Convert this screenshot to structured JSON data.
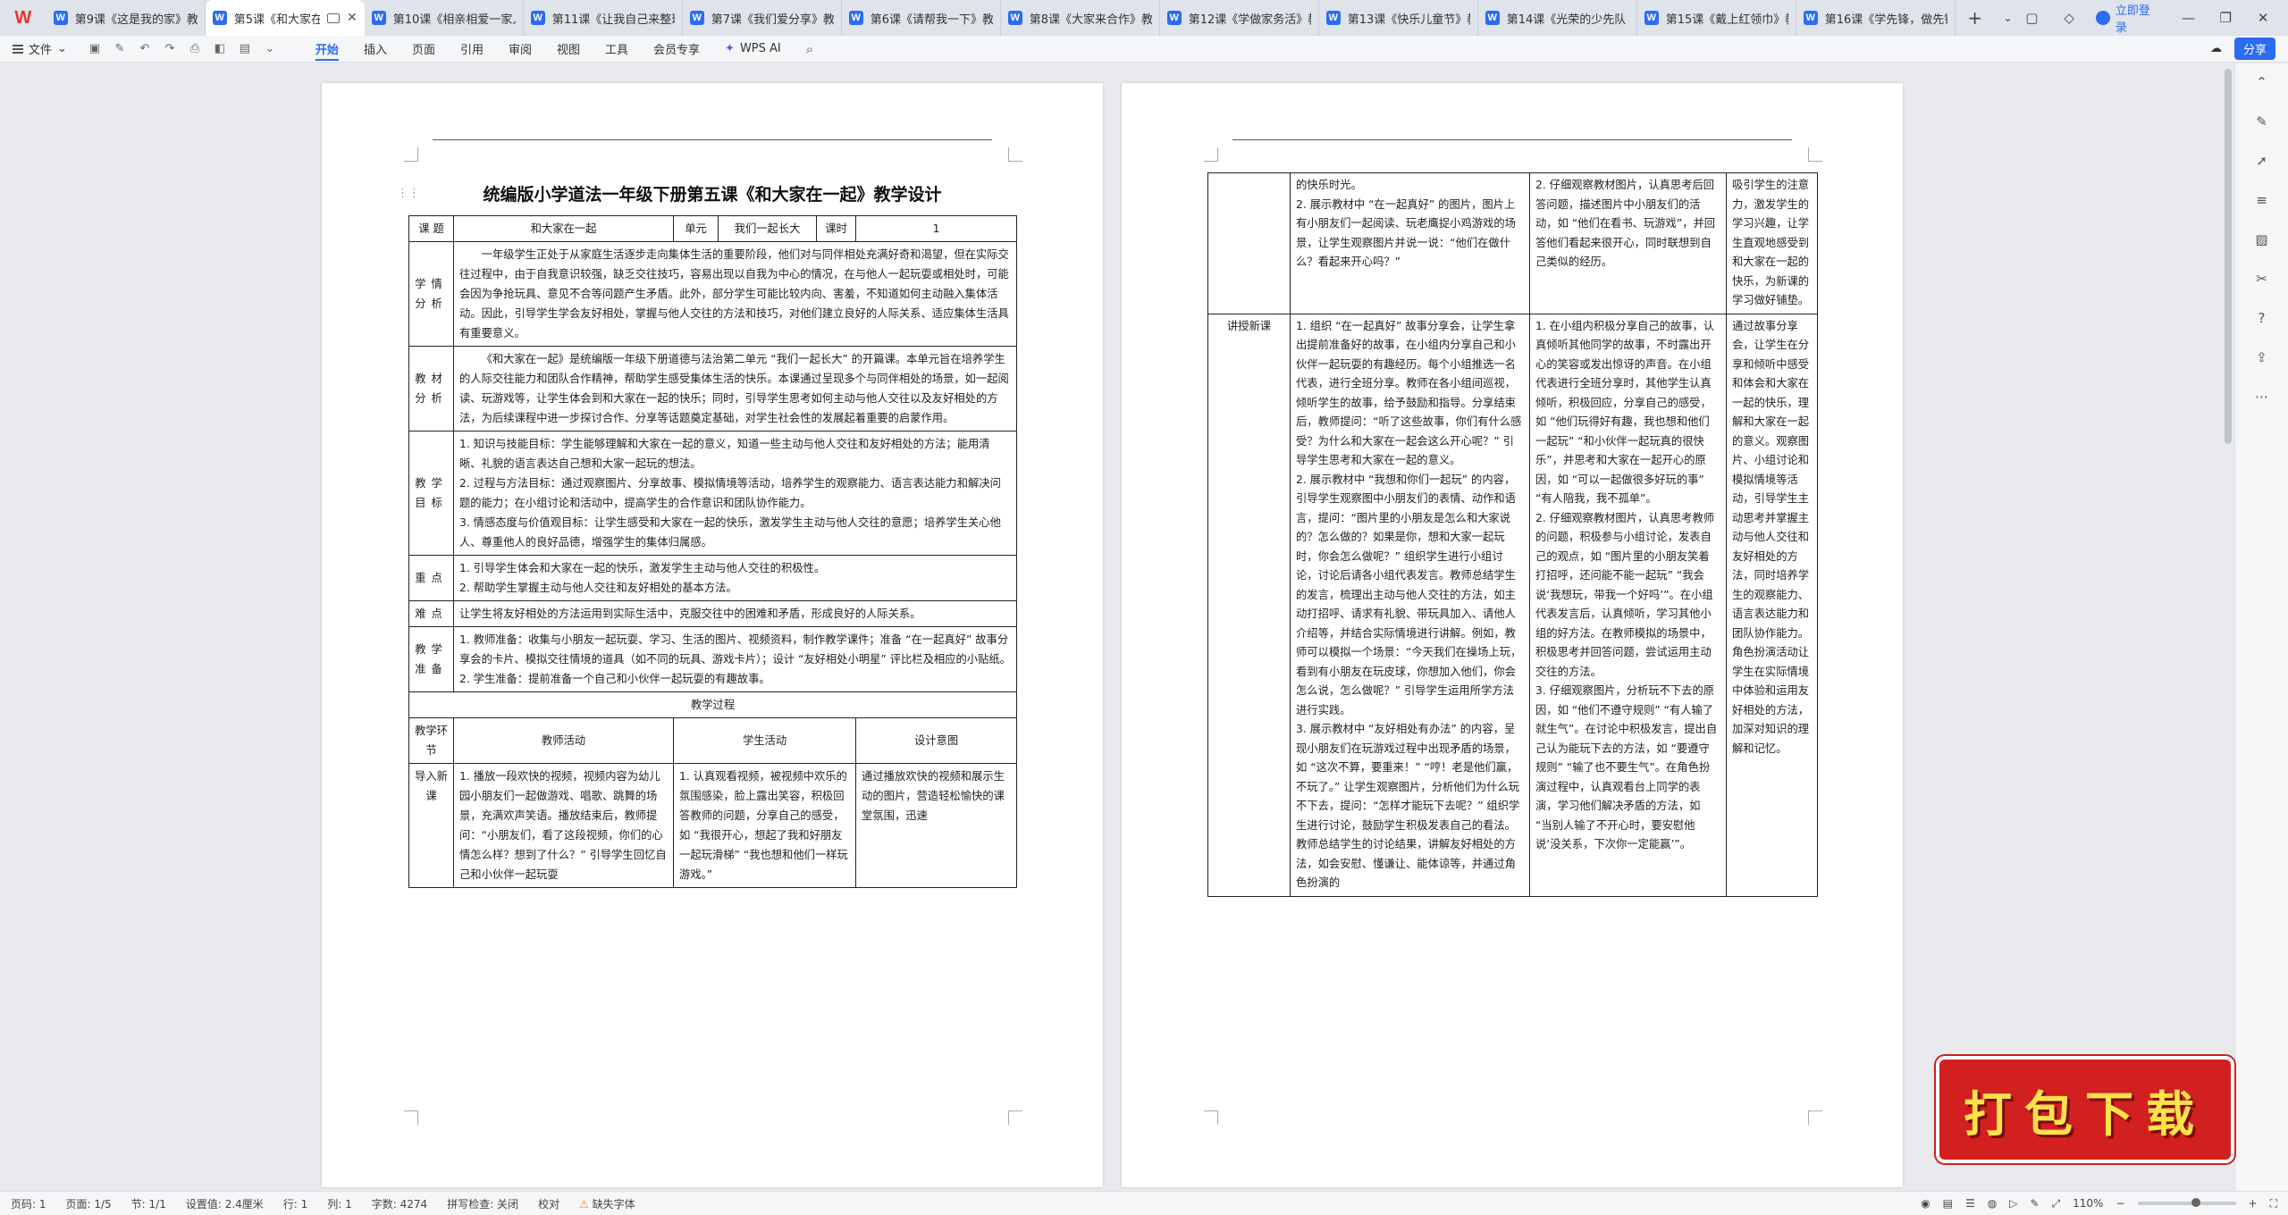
{
  "tabs": [
    {
      "label": "第9课《这是我的家》教",
      "active": false
    },
    {
      "label": "第5课《和大家在",
      "active": true
    },
    {
      "label": "第10课《相亲相爱一家人",
      "active": false
    },
    {
      "label": "第11课《让我自己来整理",
      "active": false
    },
    {
      "label": "第7课《我们爱分享》教",
      "active": false
    },
    {
      "label": "第6课《请帮我一下》教",
      "active": false
    },
    {
      "label": "第8课《大家来合作》教",
      "active": false
    },
    {
      "label": "第12课《学做家务活》教",
      "active": false
    },
    {
      "label": "第13课《快乐儿童节》教",
      "active": false
    },
    {
      "label": "第14课《光荣的少先队",
      "active": false
    },
    {
      "label": "第15课《戴上红领巾》教",
      "active": false
    },
    {
      "label": "第16课《学先锋，做先锋",
      "active": false
    }
  ],
  "login_label": "立即登录",
  "ribbon": {
    "file": "文件",
    "menus": [
      "开始",
      "插入",
      "页面",
      "引用",
      "审阅",
      "视图",
      "工具",
      "会员专享"
    ],
    "active_menu": "开始",
    "wps_ai": "WPS AI",
    "share": "分享"
  },
  "doc": {
    "title": "统编版小学道法一年级下册第五课《和大家在一起》教学设计",
    "header_row": {
      "k_topic": "课  题",
      "v_topic": "和大家在一起",
      "k_unit": "单元",
      "v_unit": "我们一起长大",
      "k_period": "课时",
      "v_period": "1"
    },
    "sections": {
      "xueqing": {
        "label": "学情分析",
        "text": "一年级学生正处于从家庭生活逐步走向集体生活的重要阶段，他们对与同伴相处充满好奇和渴望，但在实际交往过程中，由于自我意识较强，缺乏交往技巧，容易出现以自我为中心的情况，在与他人一起玩耍或相处时，可能会因为争抢玩具、意见不合等问题产生矛盾。此外，部分学生可能比较内向、害羞，不知道如何主动融入集体活动。因此，引导学生学会友好相处，掌握与他人交往的方法和技巧，对他们建立良好的人际关系、适应集体生活具有重要意义。"
      },
      "jiaocai": {
        "label": "教材分析",
        "text": "《和大家在一起》是统编版一年级下册道德与法治第二单元 “我们一起长大” 的开篇课。本单元旨在培养学生的人际交往能力和团队合作精神，帮助学生感受集体生活的快乐。本课通过呈现多个与同伴相处的场景，如一起阅读、玩游戏等，让学生体会到和大家在一起的快乐；同时，引导学生思考如何主动与他人交往以及友好相处的方法，为后续课程中进一步探讨合作、分享等话题奠定基础，对学生社会性的发展起着重要的启蒙作用。"
      },
      "mubiao": {
        "label": "教学目标",
        "items": [
          "1. 知识与技能目标：学生能够理解和大家在一起的意义，知道一些主动与他人交往和友好相处的方法；能用清晰、礼貌的语言表达自己想和大家一起玩的想法。",
          "2. 过程与方法目标：通过观察图片、分享故事、模拟情境等活动，培养学生的观察能力、语言表达能力和解决问题的能力；在小组讨论和活动中，提高学生的合作意识和团队协作能力。",
          "3. 情感态度与价值观目标：让学生感受和大家在一起的快乐，激发学生主动与他人交往的意愿；培养学生关心他人、尊重他人的良好品德，增强学生的集体归属感。"
        ]
      },
      "zhongdian": {
        "label": "重点",
        "items": [
          "1. 引导学生体会和大家在一起的快乐，激发学生主动与他人交往的积极性。",
          "2. 帮助学生掌握主动与他人交往和友好相处的基本方法。"
        ]
      },
      "nandian": {
        "label": "难点",
        "text": "让学生将友好相处的方法运用到实际生活中，克服交往中的困难和矛盾，形成良好的人际关系。"
      },
      "zhunbei": {
        "label": "教学准备",
        "items": [
          "1. 教师准备：收集与小朋友一起玩耍、学习、生活的图片、视频资料，制作教学课件；准备 “在一起真好” 故事分享会的卡片、模拟交往情境的道具（如不同的玩具、游戏卡片）；设计 “友好相处小明星” 评比栏及相应的小贴纸。",
          "2. 学生准备：提前准备一个自己和小伙伴一起玩耍的有趣故事。"
        ]
      }
    },
    "process": {
      "title": "教学过程",
      "cols": [
        "教学环节",
        "教师活动",
        "学生活动",
        "设计意图"
      ],
      "p1_rows": [
        {
          "stage": "导入新课",
          "teacher": "1. 播放一段欢快的视频，视频内容为幼儿园小朋友们一起做游戏、唱歌、跳舞的场景，充满欢声笑语。播放结束后，教师提问：“小朋友们，看了这段视频，你们的心情怎么样？想到了什么？” 引导学生回忆自己和小伙伴一起玩耍",
          "student": "1. 认真观看视频，被视频中欢乐的氛围感染，脸上露出笑容，积极回答教师的问题，分享自己的感受，如 “我很开心，想起了我和好朋友一起玩滑梯” “我也想和他们一样玩游戏。”",
          "intent": "通过播放欢快的视频和展示生动的图片，营造轻松愉快的课堂氛围，迅速"
        }
      ],
      "p2_rows": [
        {
          "stage": "",
          "teacher": "的快乐时光。\n2. 展示教材中 “在一起真好” 的图片，图片上有小朋友们一起阅读、玩老鹰捉小鸡游戏的场景，让学生观察图片并说一说：“他们在做什么？看起来开心吗？”",
          "student": "2. 仔细观察教材图片，认真思考后回答问题，描述图片中小朋友们的活动，如 “他们在看书、玩游戏”，并回答他们看起来很开心，同时联想到自己类似的经历。",
          "intent": "吸引学生的注意力，激发学生的学习兴趣，让学生直观地感受到和大家在一起的快乐，为新课的学习做好铺垫。"
        },
        {
          "stage": "讲授新课",
          "teacher": "1. 组织 “在一起真好” 故事分享会，让学生拿出提前准备好的故事，在小组内分享自己和小伙伴一起玩耍的有趣经历。每个小组推选一名代表，进行全班分享。教师在各小组间巡视，倾听学生的故事，给予鼓励和指导。分享结束后，教师提问：“听了这些故事，你们有什么感受？为什么和大家在一起会这么开心呢？” 引导学生思考和大家在一起的意义。\n2. 展示教材中 “我想和你们一起玩” 的内容，引导学生观察图中小朋友们的表情、动作和语言，提问：“图片里的小朋友是怎么和大家说的？怎么做的？如果是你，想和大家一起玩时，你会怎么做呢？” 组织学生进行小组讨论，讨论后请各小组代表发言。教师总结学生的发言，梳理出主动与他人交往的方法，如主动打招呼、请求有礼貌、带玩具加入、请他人介绍等，并结合实际情境进行讲解。例如，教师可以模拟一个场景：“今天我们在操场上玩，看到有小朋友在玩皮球，你想加入他们，你会怎么说，怎么做呢？” 引导学生运用所学方法进行实践。\n3. 展示教材中 “友好相处有办法” 的内容，呈现小朋友们在玩游戏过程中出现矛盾的场景，如 “这次不算，要重来！” “哼！老是他们赢，不玩了。” 让学生观察图片，分析他们为什么玩不下去，提问：“怎样才能玩下去呢？” 组织学生进行讨论，鼓励学生积极发表自己的看法。教师总结学生的讨论结果，讲解友好相处的方法，如会安慰、懂谦让、能体谅等，并通过角色扮演的",
          "student": "1. 在小组内积极分享自己的故事，认真倾听其他同学的故事，不时露出开心的笑容或发出惊讶的声音。在小组代表进行全班分享时，其他学生认真倾听，积极回应，分享自己的感受，如 “他们玩得好有趣，我也想和他们一起玩” “和小伙伴一起玩真的很快乐”，并思考和大家在一起开心的原因，如 “可以一起做很多好玩的事” “有人陪我，我不孤单”。\n2. 仔细观察教材图片，认真思考教师的问题，积极参与小组讨论，发表自己的观点，如 “图片里的小朋友笑着打招呼，还问能不能一起玩” “我会说‘我想玩，带我一个好吗’”。在小组代表发言后，认真倾听，学习其他小组的好方法。在教师模拟的场景中，积极思考并回答问题，尝试运用主动交往的方法。\n3. 仔细观察图片，分析玩不下去的原因，如 “他们不遵守规则” “有人输了就生气”。在讨论中积极发言，提出自己认为能玩下去的方法，如 “要遵守规则” “输了也不要生气”。在角色扮演过程中，认真观看台上同学的表演，学习他们解决矛盾的方法，如 “当别人输了不开心时，要安慰他说‘没关系，下次你一定能赢’”。",
          "intent": "通过故事分享会，让学生在分享和倾听中感受和体会和大家在一起的快乐，理解和大家在一起的意义。观察图片、小组讨论和模拟情境等活动，引导学生主动思考并掌握主动与他人交往和友好相处的方法，同时培养学生的观察能力、语言表达能力和团队协作能力。角色扮演活动让学生在实际情境中体验和运用友好相处的方法，加深对知识的理解和记忆。"
        }
      ]
    }
  },
  "badge": "打包下载",
  "status": {
    "page": "页码: 1",
    "pages": "页面: 1/5",
    "section": "节: 1/1",
    "setting": "设置值: 2.4厘米",
    "row": "行: 1",
    "col": "列: 1",
    "words": "字数: 4274",
    "spell": "拼写检查: 关闭",
    "proof": "校对",
    "missing_font": "缺失字体",
    "zoom": "110%",
    "zoom_value": 0.55
  }
}
